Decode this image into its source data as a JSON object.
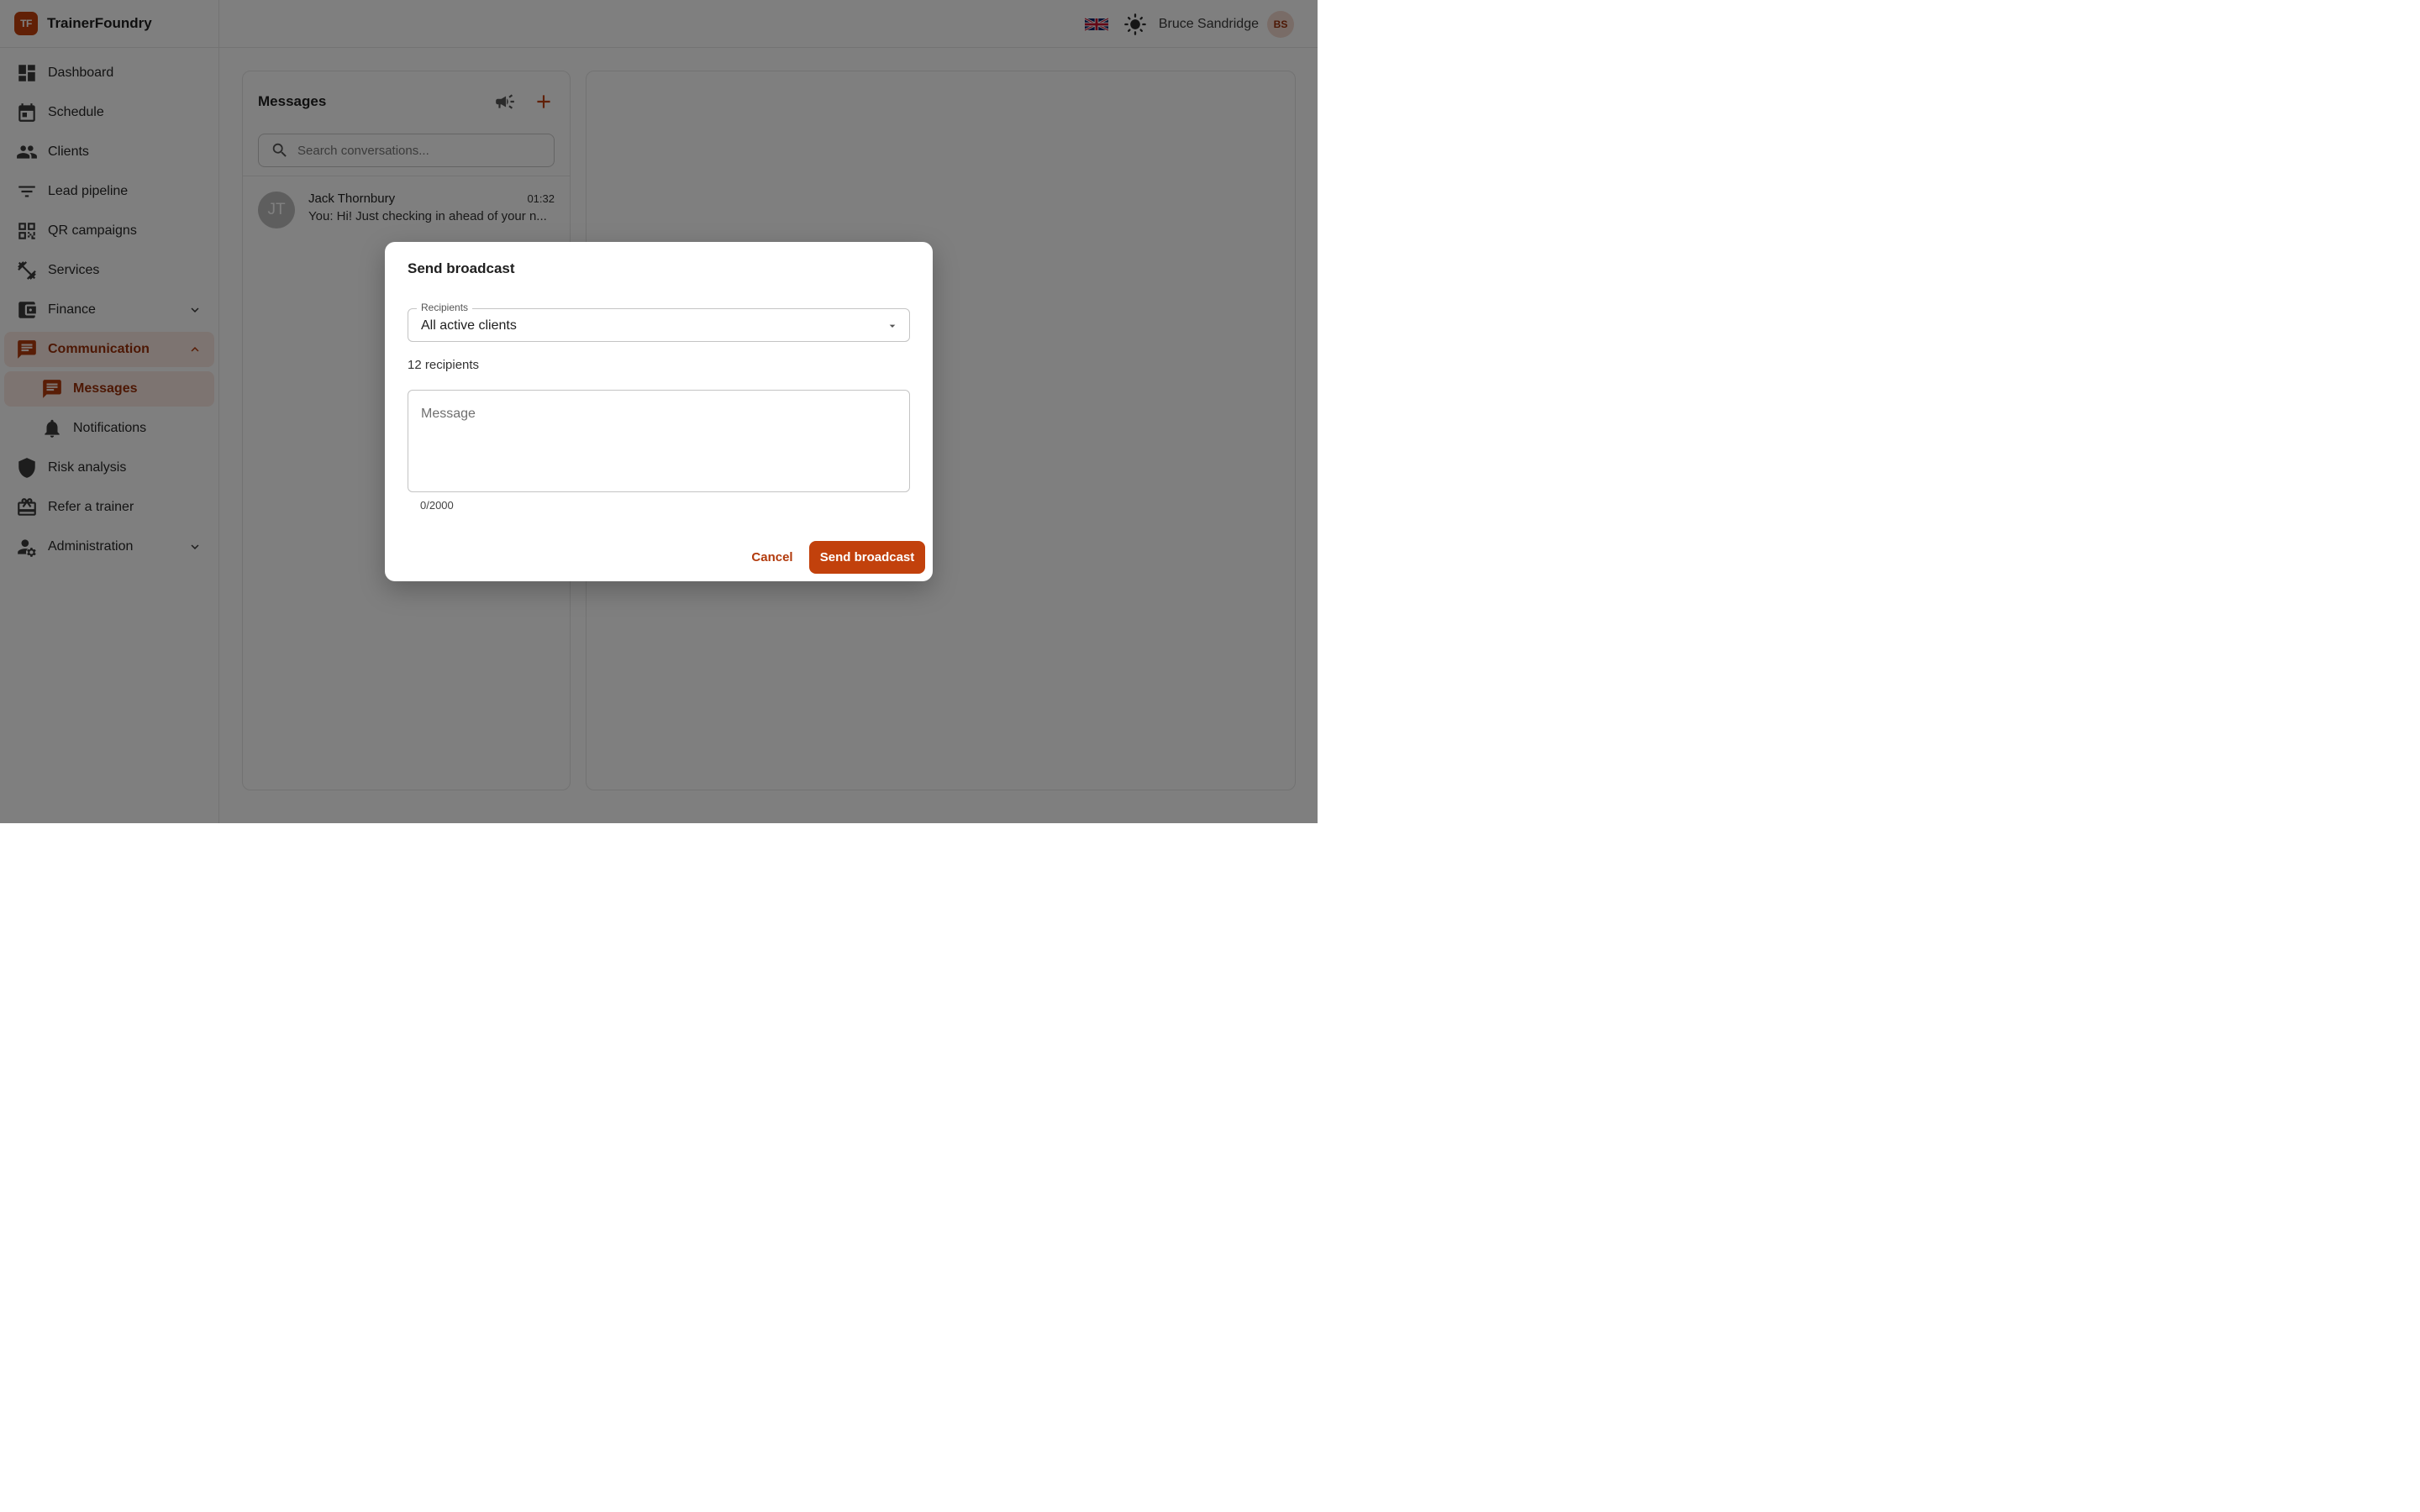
{
  "brand": {
    "logo_text": "TF",
    "name": "TrainerFoundry"
  },
  "sidebar": {
    "items": [
      {
        "label": "Dashboard",
        "icon": "dashboard-icon"
      },
      {
        "label": "Schedule",
        "icon": "calendar-icon"
      },
      {
        "label": "Clients",
        "icon": "people-icon"
      },
      {
        "label": "Lead pipeline",
        "icon": "filter-icon"
      },
      {
        "label": "QR campaigns",
        "icon": "qr-code-icon"
      },
      {
        "label": "Services",
        "icon": "dumbbell-icon"
      },
      {
        "label": "Finance",
        "icon": "wallet-icon",
        "expandable": true,
        "expanded": false
      },
      {
        "label": "Communication",
        "icon": "chat-icon",
        "expandable": true,
        "expanded": true,
        "active": true
      },
      {
        "label": "Messages",
        "icon": "chat-icon",
        "sub": true,
        "active": true
      },
      {
        "label": "Notifications",
        "icon": "bell-icon",
        "sub": true
      },
      {
        "label": "Risk analysis",
        "icon": "shield-icon"
      },
      {
        "label": "Refer a trainer",
        "icon": "gift-icon"
      },
      {
        "label": "Administration",
        "icon": "user-cog-icon",
        "expandable": true,
        "expanded": false
      }
    ]
  },
  "topbar": {
    "language_icon": "uk-flag-icon",
    "theme_icon": "sun-icon",
    "user_name": "Bruce Sandridge",
    "user_initials": "BS"
  },
  "messages": {
    "title": "Messages",
    "search_placeholder": "Search conversations...",
    "conversations": [
      {
        "initials": "JT",
        "name": "Jack Thornbury",
        "time": "01:32",
        "preview": "You: Hi! Just checking in ahead of your n..."
      }
    ]
  },
  "dialog": {
    "title": "Send broadcast",
    "recipients_label": "Recipients",
    "recipients_value": "All active clients",
    "recipient_count": "12 recipients",
    "message_placeholder": "Message",
    "char_count": "0/2000",
    "cancel_label": "Cancel",
    "send_label": "Send broadcast"
  },
  "colors": {
    "accent": "#c2410c",
    "accent_text": "#9a2f08",
    "active_bg": "#fbe9e2",
    "overlay": "rgba(0,0,0,0.5)"
  }
}
